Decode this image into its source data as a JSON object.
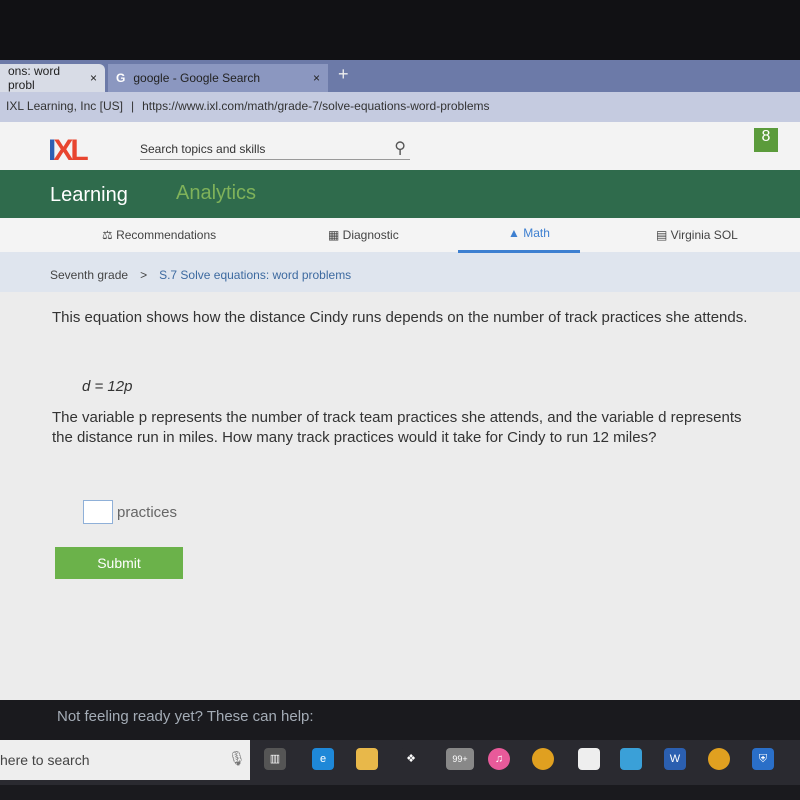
{
  "browser": {
    "tabs": [
      {
        "label": "ons: word probl",
        "close": "×"
      },
      {
        "label": "google - Google Search",
        "close": "×",
        "icon": "google-g-icon"
      }
    ],
    "new_tab": "+",
    "site_identity": "IXL Learning, Inc [US]",
    "url": "https://www.ixl.com/math/grade-7/solve-equations-word-problems"
  },
  "header": {
    "logo": "IXL",
    "search_placeholder": "Search topics and skills",
    "user_initial": "8"
  },
  "nav": {
    "learning": "Learning",
    "analytics": "Analytics"
  },
  "subnav": [
    "Recommendations",
    "Diagnostic",
    "Math",
    "Virginia SOL"
  ],
  "breadcrumb": {
    "grade": "Seventh grade",
    "sep": ">",
    "skill": "S.7 Solve equations: word problems"
  },
  "question": {
    "intro": "This equation shows how the distance Cindy runs depends on the number of track practices she attends.",
    "equation": "d = 12p",
    "body": "The variable p represents the number of track team practices she attends, and the variable d represents the distance run in miles. How many track practices would it take for Cindy to run 12 miles?",
    "unit": "practices",
    "answer": ""
  },
  "submit": "Submit",
  "help": "Not feeling ready yet? These can help:",
  "taskbar": {
    "search": "here to search",
    "mail_badge": "99+"
  },
  "colors": {
    "nav": "#2f6b4c",
    "accent": "#3d7fd0",
    "submit": "#6bb24a"
  }
}
